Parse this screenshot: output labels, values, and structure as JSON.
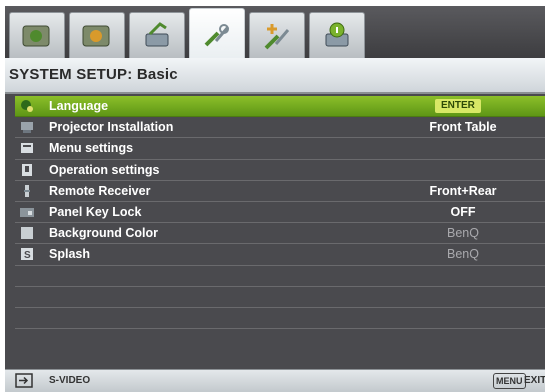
{
  "tabs": [
    {
      "icon": "picture-tab-icon",
      "active": false
    },
    {
      "icon": "picture-advanced-tab-icon",
      "active": false
    },
    {
      "icon": "display-tab-icon",
      "active": false
    },
    {
      "icon": "system-setup-basic-tab-icon",
      "active": true
    },
    {
      "icon": "system-setup-advanced-tab-icon",
      "active": false
    },
    {
      "icon": "information-tab-icon",
      "active": false
    }
  ],
  "header": {
    "title": "SYSTEM SETUP: Basic"
  },
  "menu": {
    "items": [
      {
        "icon": "language-icon",
        "label": "Language",
        "value": "ENTER",
        "selected": true
      },
      {
        "icon": "projector-installation-icon",
        "label": "Projector Installation",
        "value": "Front Table"
      },
      {
        "icon": "menu-settings-icon",
        "label": "Menu settings",
        "value": ""
      },
      {
        "icon": "operation-settings-icon",
        "label": "Operation settings",
        "value": ""
      },
      {
        "icon": "remote-receiver-icon",
        "label": "Remote Receiver",
        "value": "Front+Rear"
      },
      {
        "icon": "panel-key-lock-icon",
        "label": "Panel Key Lock",
        "value": "OFF"
      },
      {
        "icon": "background-color-icon",
        "label": "Background Color",
        "value": "BenQ"
      },
      {
        "icon": "splash-icon",
        "label": "Splash",
        "value": "BenQ"
      }
    ]
  },
  "footer": {
    "source_label": "S-VIDEO",
    "menu_key": "MENU",
    "exit_label": "EXIT"
  },
  "colors": {
    "selected_row": "#7aae22",
    "panel_bg": "#4a4a4e",
    "enter_badge": "#d8e866"
  }
}
